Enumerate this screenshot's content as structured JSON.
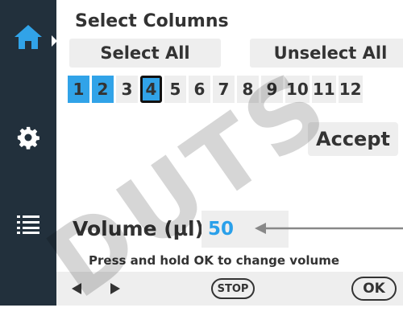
{
  "sidebar": {
    "items": [
      {
        "icon": "home-icon",
        "active": true
      },
      {
        "icon": "gear-icon",
        "active": false
      },
      {
        "icon": "list-icon",
        "active": false
      }
    ],
    "active_color": "#31a3e8"
  },
  "select_columns": {
    "title": "Select Columns",
    "select_all_label": "Select All",
    "unselect_all_label": "Unselect All",
    "columns": [
      {
        "label": "1",
        "selected": true
      },
      {
        "label": "2",
        "selected": true
      },
      {
        "label": "3",
        "selected": false
      },
      {
        "label": "4",
        "selected": true,
        "focused": true
      },
      {
        "label": "5",
        "selected": false
      },
      {
        "label": "6",
        "selected": false
      },
      {
        "label": "7",
        "selected": false
      },
      {
        "label": "8",
        "selected": false
      },
      {
        "label": "9",
        "selected": false
      },
      {
        "label": "10",
        "selected": false
      },
      {
        "label": "11",
        "selected": false
      },
      {
        "label": "12",
        "selected": false
      }
    ],
    "accept_label": "Accept"
  },
  "volume": {
    "label": "Volume (µl)",
    "value": "50",
    "hint": "Press and hold OK to change volume"
  },
  "bottom_bar": {
    "prev_icon": "left-arrow-icon",
    "next_icon": "right-arrow-icon",
    "stop_label": "STOP",
    "ok_label": "OK"
  },
  "watermark": "DUTS",
  "colors": {
    "sidebar_bg": "#22303c",
    "selected_blue": "#31a3e8",
    "button_bg": "#eeeeee",
    "volume_text": "#2aa0ea"
  }
}
